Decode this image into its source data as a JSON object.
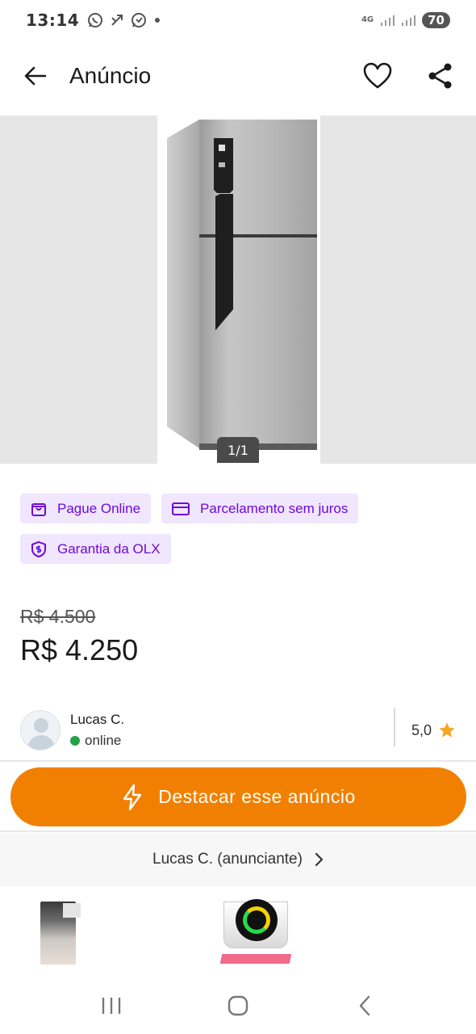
{
  "status_bar": {
    "time": "13:14",
    "left_icons": [
      "whatsapp-icon",
      "missed-call-icon",
      "whatsapp-business-icon",
      "dot-icon"
    ],
    "network_label": "4G",
    "battery": "70"
  },
  "header": {
    "title": "Anúncio",
    "back_icon": "arrow-left-icon",
    "favorite_icon": "heart-icon",
    "share_icon": "share-icon"
  },
  "gallery": {
    "counter": "1/1"
  },
  "badges": [
    {
      "label": "Pague Online",
      "icon": "bag-icon"
    },
    {
      "label": "Parcelamento sem juros",
      "icon": "card-icon"
    },
    {
      "label": "Garantia da OLX",
      "icon": "shield-dollar-icon"
    }
  ],
  "pricing": {
    "old_price": "R$ 4.500",
    "price": "R$ 4.250"
  },
  "seller": {
    "name": "Lucas C.",
    "status": "online",
    "rating": "5,0"
  },
  "cta": {
    "label": "Destacar esse anúncio",
    "icon": "lightning-icon"
  },
  "advertiser_link": {
    "label": "Lucas C. (anunciante)"
  },
  "nav": {
    "recent": "recent-apps-icon",
    "home": "home-icon",
    "back": "back-icon"
  },
  "colors": {
    "brand_orange": "#f28000",
    "badge_purple": "#6e0ad6",
    "badge_bg": "#f0e6fd",
    "online_green": "#24a148",
    "star": "#f5a623"
  }
}
